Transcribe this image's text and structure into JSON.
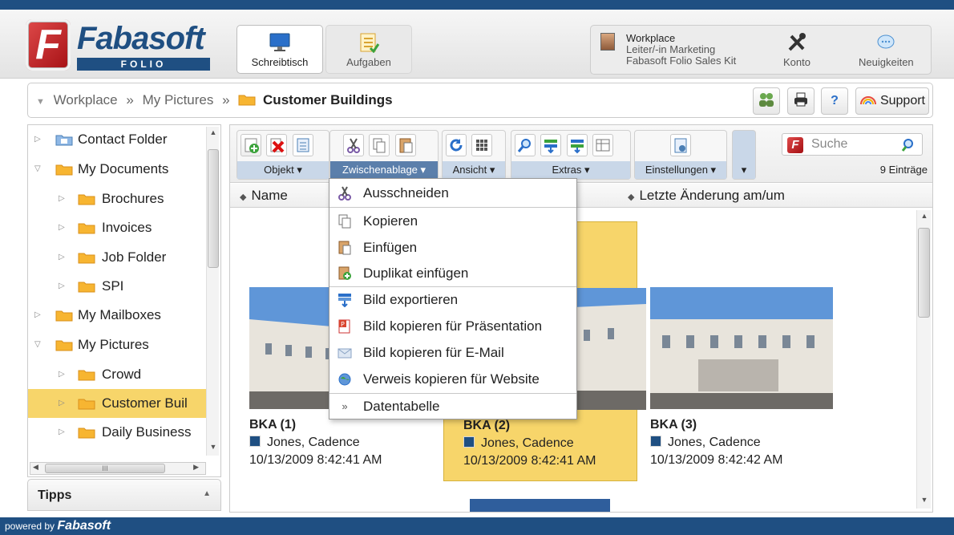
{
  "header": {
    "logo_word": "Fabasoft",
    "logo_sub": "FOLIO",
    "nav": [
      {
        "label": "Schreibtisch"
      },
      {
        "label": "Aufgaben"
      }
    ],
    "workplace": {
      "title": "Workplace",
      "role": "Leiter/-in Marketing",
      "kit": "Fabasoft Folio Sales Kit"
    },
    "konto": "Konto",
    "neuigkeiten": "Neuigkeiten"
  },
  "breadcrumb": {
    "items": [
      "Workplace",
      "My Pictures",
      "Customer Buildings"
    ],
    "separator": "»",
    "support_label": "Support",
    "help_label": "?"
  },
  "sidebar": {
    "tree": [
      {
        "label": "Contact Folder"
      },
      {
        "label": "My Documents"
      },
      {
        "label": "Brochures"
      },
      {
        "label": "Invoices"
      },
      {
        "label": "Job Folder"
      },
      {
        "label": "SPI"
      },
      {
        "label": "My Mailboxes"
      },
      {
        "label": "My Pictures"
      },
      {
        "label": "Crowd"
      },
      {
        "label": "Customer Buil"
      },
      {
        "label": "Daily Business"
      }
    ],
    "hscroll_grip": "III",
    "tipps_label": "Tipps"
  },
  "toolbar": {
    "groups": [
      {
        "label": "Objekt ▾"
      },
      {
        "label": "Zwischenablage ▾"
      },
      {
        "label": "Ansicht ▾"
      },
      {
        "label": "Extras ▾"
      },
      {
        "label": "Einstellungen ▾"
      },
      {
        "label": "▾"
      }
    ],
    "search_placeholder": "Suche",
    "count": "9 Einträge"
  },
  "columns": {
    "name": "Name",
    "modified": "Letzte Änderung am/um"
  },
  "tiles": [
    {
      "title": "BKA (1)",
      "owner": "Jones, Cadence",
      "date": "10/13/2009 8:42:41 AM"
    },
    {
      "title": "BKA (2)",
      "owner": "Jones, Cadence",
      "date": "10/13/2009 8:42:41 AM"
    },
    {
      "title": "BKA (3)",
      "owner": "Jones, Cadence",
      "date": "10/13/2009 8:42:42 AM"
    }
  ],
  "context_menu": {
    "items": [
      {
        "label": "Ausschneiden"
      },
      {
        "label": "Kopieren"
      },
      {
        "label": "Einfügen"
      },
      {
        "label": "Duplikat einfügen"
      },
      {
        "label": "Bild exportieren"
      },
      {
        "label": "Bild kopieren für Präsentation"
      },
      {
        "label": "Bild kopieren für E-Mail"
      },
      {
        "label": "Verweis kopieren für Website"
      },
      {
        "label": "Datentabelle"
      }
    ]
  },
  "footer": {
    "prefix": "powered by",
    "brand": "Fabasoft"
  },
  "colors": {
    "brand_blue": "#1f4f82",
    "selection_yellow": "#f7d56a",
    "logo_red": "#c0161b"
  }
}
